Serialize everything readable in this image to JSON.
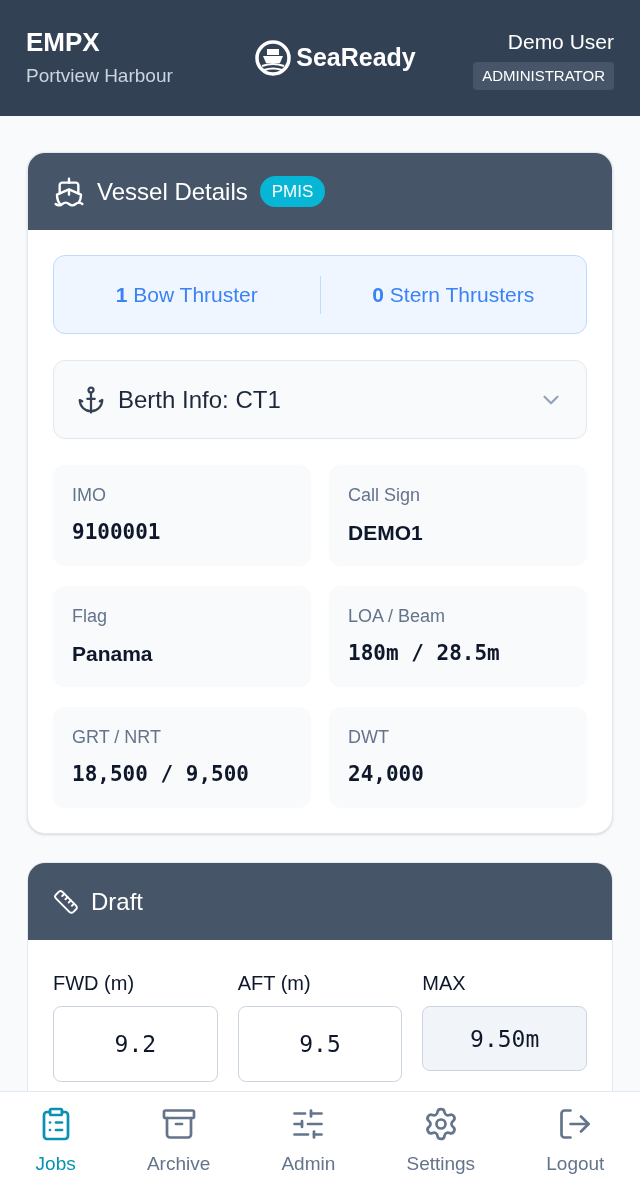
{
  "header": {
    "code": "EMPX",
    "port": "Portview Harbour",
    "brand": "SeaReady",
    "user": "Demo User",
    "role": "ADMINISTRATOR"
  },
  "vessel": {
    "title": "Vessel Details",
    "badge": "PMIS",
    "thrusters": [
      {
        "count": "1",
        "label": "Bow Thruster"
      },
      {
        "count": "0",
        "label": "Stern Thrusters"
      }
    ],
    "berth": {
      "label": "Berth Info: CT1",
      "expanded": false
    },
    "fields": [
      {
        "label": "IMO",
        "value": "9100001",
        "kind": "code"
      },
      {
        "label": "Call Sign",
        "value": "DEMO1",
        "kind": "text"
      },
      {
        "label": "Flag",
        "value": "Panama",
        "kind": "text"
      },
      {
        "label": "LOA / Beam",
        "value": "180m / 28.5m",
        "kind": "code"
      },
      {
        "label": "GRT / NRT",
        "value": "18,500 / 9,500",
        "kind": "code"
      },
      {
        "label": "DWT",
        "value": "24,000",
        "kind": "code"
      }
    ]
  },
  "draft": {
    "title": "Draft",
    "fields": [
      {
        "label": "FWD (m)",
        "value": "9.2",
        "readonly": false
      },
      {
        "label": "AFT (m)",
        "value": "9.5",
        "readonly": false
      },
      {
        "label": "MAX",
        "value": "9.50m",
        "readonly": true
      }
    ]
  },
  "nav": [
    {
      "label": "Jobs",
      "selected": true
    },
    {
      "label": "Archive",
      "selected": false
    },
    {
      "label": "Admin",
      "selected": false
    },
    {
      "label": "Settings",
      "selected": false
    },
    {
      "label": "Logout",
      "selected": false
    }
  ]
}
